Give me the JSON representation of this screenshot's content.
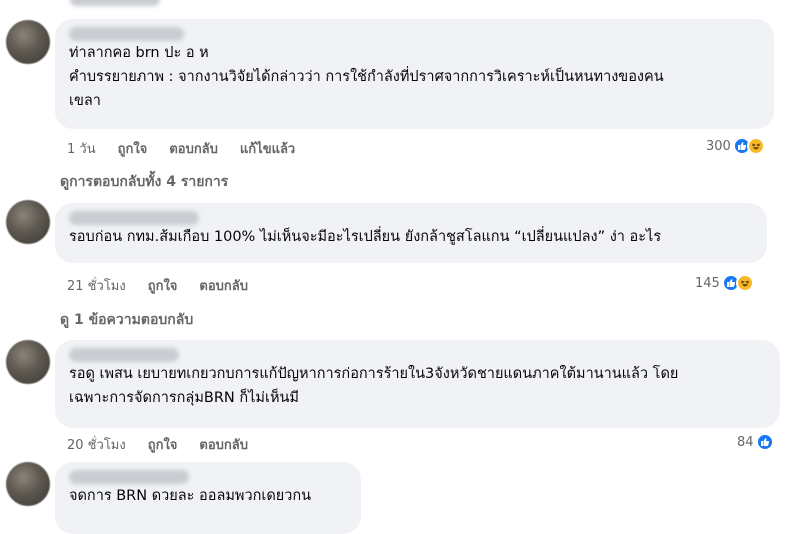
{
  "comments": [
    {
      "text": "ท่าลากคอ brn ปะ อ ห\nคำบรรยายภาพ : จากงานวิจัยได้กล่าวว่า การใช้กำลังที่ปราศจากการวิเคราะห์เป็นหนทางของคน\nเขลา",
      "time": "1 วัน",
      "like": "ถูกใจ",
      "reply": "ตอบกลับ",
      "edited": "แก้ไขแล้ว",
      "reactions_count": "300"
    },
    {
      "text": "รอบก่อน กทม.ส้มเกือบ 100% ไม่เห็นจะมีอะไรเปลี่ยน ยังกล้าชูสโลแกน “เปลี่ยนแปลง” ง่า อะไร",
      "time": "21 ชั่วโมง",
      "like": "ถูกใจ",
      "reply": "ตอบกลับ",
      "reactions_count": "145"
    },
    {
      "text": "รอดู เพสน เยบายทเกยวกบการแก้ปัญหาการก่อการร้ายใน3จังหวัดชายแดนภาคใต้มานานแล้ว โดย\nเฉพาะการจัดการกลุ่มBRN ก็ไม่เห็นมี",
      "time": "20 ชั่วโมง",
      "like": "ถูกใจ",
      "reply": "ตอบกลับ",
      "reactions_count": "84"
    },
    {
      "text": "จดการ BRN ดวยละ ออลมพวกเดยวกน"
    }
  ],
  "view_replies_1": "ดูการตอบกลับทั้ง 4 รายการ",
  "view_replies_2": "ดู 1 ข้อความตอบกลับ",
  "colors": {
    "bubble": "#f0f2f5",
    "meta": "#65676b",
    "like_blue": "#1877f2",
    "haha_yellow": "#f7b928"
  }
}
